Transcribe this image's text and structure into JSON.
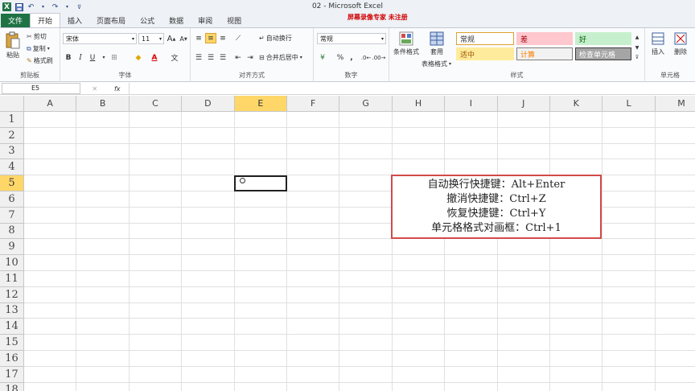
{
  "window": {
    "title": "02 - Microsoft Excel",
    "watermark": "屏幕录像专家 未注册"
  },
  "quick_access": {
    "logo": "X",
    "save_icon": "save-icon",
    "undo_icon": "undo-icon",
    "redo_icon": "redo-icon",
    "menu_icon": "customize-icon"
  },
  "tabs": [
    "文件",
    "开始",
    "插入",
    "页面布局",
    "公式",
    "数据",
    "审阅",
    "视图"
  ],
  "active_tab": "开始",
  "ribbon": {
    "clipboard": {
      "label": "剪贴板",
      "paste": "粘贴",
      "cut": "剪切",
      "copy": "复制",
      "format_painter": "格式刷"
    },
    "font": {
      "label": "字体",
      "font_name": "宋体",
      "font_size": "11",
      "grow": "A",
      "shrink": "A",
      "bold": "B",
      "italic": "I",
      "underline": "U"
    },
    "alignment": {
      "label": "对齐方式",
      "wrap": "自动换行",
      "merge": "合并后居中"
    },
    "number": {
      "label": "数字",
      "format": "常规",
      "percent": "%",
      "comma": ","
    },
    "styles": {
      "label": "样式",
      "conditional": "条件格式",
      "table_format": "套用",
      "table_format2": "表格格式",
      "cells": [
        {
          "text": "常规",
          "bg": "#ffffff",
          "border": "#e0a030",
          "color": "#333333"
        },
        {
          "text": "差",
          "bg": "#ffc7ce",
          "border": "#ffc7ce",
          "color": "#9c0006"
        },
        {
          "text": "好",
          "bg": "#c6efce",
          "border": "#c6efce",
          "color": "#006100"
        },
        {
          "text": "适中",
          "bg": "#ffeb9c",
          "border": "#ffeb9c",
          "color": "#9c5700"
        },
        {
          "text": "计算",
          "bg": "#f2f2f2",
          "border": "#7f7f7f",
          "color": "#fa7d00"
        },
        {
          "text": "检查单元格",
          "bg": "#a5a5a5",
          "border": "#3f3f3f",
          "color": "#ffffff"
        }
      ]
    },
    "cells": {
      "label": "单元格",
      "insert": "插入",
      "delete": "删除"
    }
  },
  "formula_bar": {
    "name_box": "E5",
    "fx": "fx",
    "value": ""
  },
  "columns": [
    "A",
    "B",
    "C",
    "D",
    "E",
    "F",
    "G",
    "H",
    "I",
    "J",
    "K",
    "L",
    "M"
  ],
  "rows": [
    "1",
    "2",
    "3",
    "4",
    "5",
    "6",
    "7",
    "8",
    "9",
    "10",
    "11",
    "12",
    "13",
    "14",
    "15",
    "16",
    "17",
    "18"
  ],
  "selected_cell": {
    "column": "E",
    "row": "5"
  },
  "note_lines": [
    "自动换行快捷键：Alt+Enter",
    "撤消快捷键：Ctrl+Z",
    "恢复快捷键：Ctrl+Y",
    "单元格格式对画框：Ctrl+1"
  ],
  "colors": {
    "excel_green": "#1f7244",
    "selected_header": "#ffd768",
    "note_border": "#d24a4a"
  }
}
